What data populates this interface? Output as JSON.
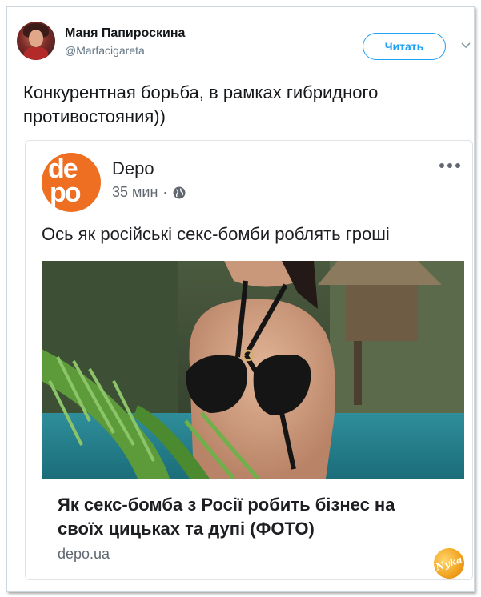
{
  "tweet": {
    "author_name": "Маня Папироскина",
    "author_handle": "@Marfacigareta",
    "follow_label": "Читать",
    "text": "Конкурентная борьба, в рамках гибридного противостояния))"
  },
  "embedded_post": {
    "page_name": "Depo",
    "logo_text_top": "de",
    "logo_text_bottom": "po",
    "time": "35 мин",
    "separator": "·",
    "text": "Ось як російські секс-бомби роблять гроші",
    "link_title": "Як секс-бомба з Росії робить бізнес на своїх цицьках та дупі (ФОТО)",
    "link_domain": "depo.ua"
  },
  "watermark": "Nyka",
  "colors": {
    "twitter_blue": "#1da1f2",
    "depo_orange": "#ee6f22",
    "text_primary": "#14171a",
    "text_secondary": "#606770"
  },
  "icons": [
    "chevron-down-icon",
    "globe-icon",
    "more-dots-icon"
  ]
}
